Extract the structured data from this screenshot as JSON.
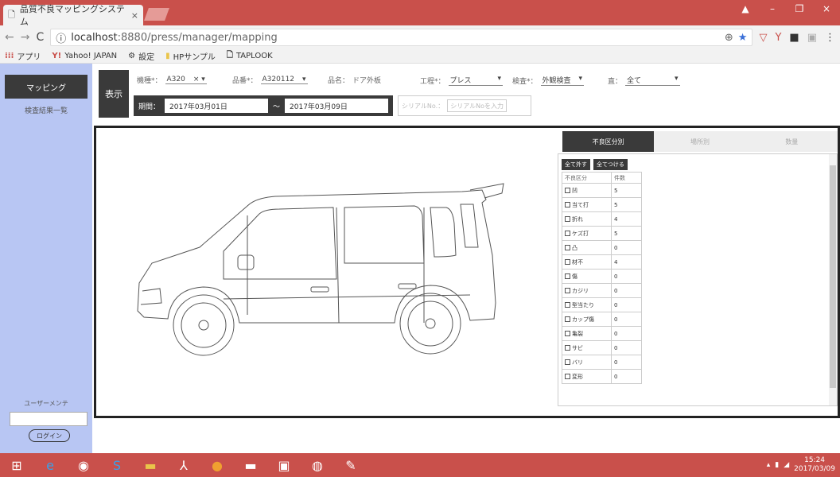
{
  "browser": {
    "tab_title": "品質不良マッピングシステム",
    "tab_close": "×",
    "url_host": "localhost",
    "url_rest": ":8880/press/manager/mapping",
    "window_controls": [
      "–",
      "❐",
      "×"
    ]
  },
  "bookmarks": [
    "アプリ",
    "Yahoo! JAPAN",
    "設定",
    "HPサンプル",
    "TAPLOOK"
  ],
  "sidebar": {
    "active_item": "マッピング",
    "link_item": "検査結果一覧",
    "user_label": "ユーザーメンテ",
    "login_button": "ログイン"
  },
  "filters": {
    "show_button": "表示",
    "model_label": "機種*：",
    "model_value": "A320",
    "part_no_label": "品番*：",
    "part_no_value": "A320112",
    "part_name_label": "品名：",
    "part_name_value": "ドア外板",
    "process_label": "工程*：",
    "process_value": "プレス",
    "inspection_label": "検査*：",
    "inspection_value": "外観検査",
    "shift_label": "直：",
    "shift_value": "全て",
    "period_label": "期間：",
    "date_from": "2017年03月01日",
    "date_sep": "〜",
    "date_to": "2017年03月09日",
    "serial_label": "シリアルNo.：",
    "serial_placeholder": "シリアルNoを入力"
  },
  "panel": {
    "tabs": [
      "不良区分別",
      "場所別",
      "数量"
    ],
    "check_all": "全て外す",
    "uncheck_all": "全てつける",
    "col_category": "不良区分",
    "col_count": "件数",
    "rows": [
      {
        "name": "凹",
        "count": "5"
      },
      {
        "name": "当て打",
        "count": "5"
      },
      {
        "name": "折れ",
        "count": "4"
      },
      {
        "name": "ケズ打",
        "count": "5"
      },
      {
        "name": "凸",
        "count": "0"
      },
      {
        "name": "材不",
        "count": "4"
      },
      {
        "name": "傷",
        "count": "0"
      },
      {
        "name": "カジリ",
        "count": "0"
      },
      {
        "name": "型当たり",
        "count": "0"
      },
      {
        "name": "カップ傷",
        "count": "0"
      },
      {
        "name": "亀裂",
        "count": "0"
      },
      {
        "name": "サビ",
        "count": "0"
      },
      {
        "name": "バリ",
        "count": "0"
      },
      {
        "name": "変形",
        "count": "0"
      }
    ]
  },
  "taskbar": {
    "time": "15:24",
    "date": "2017/03/09"
  }
}
